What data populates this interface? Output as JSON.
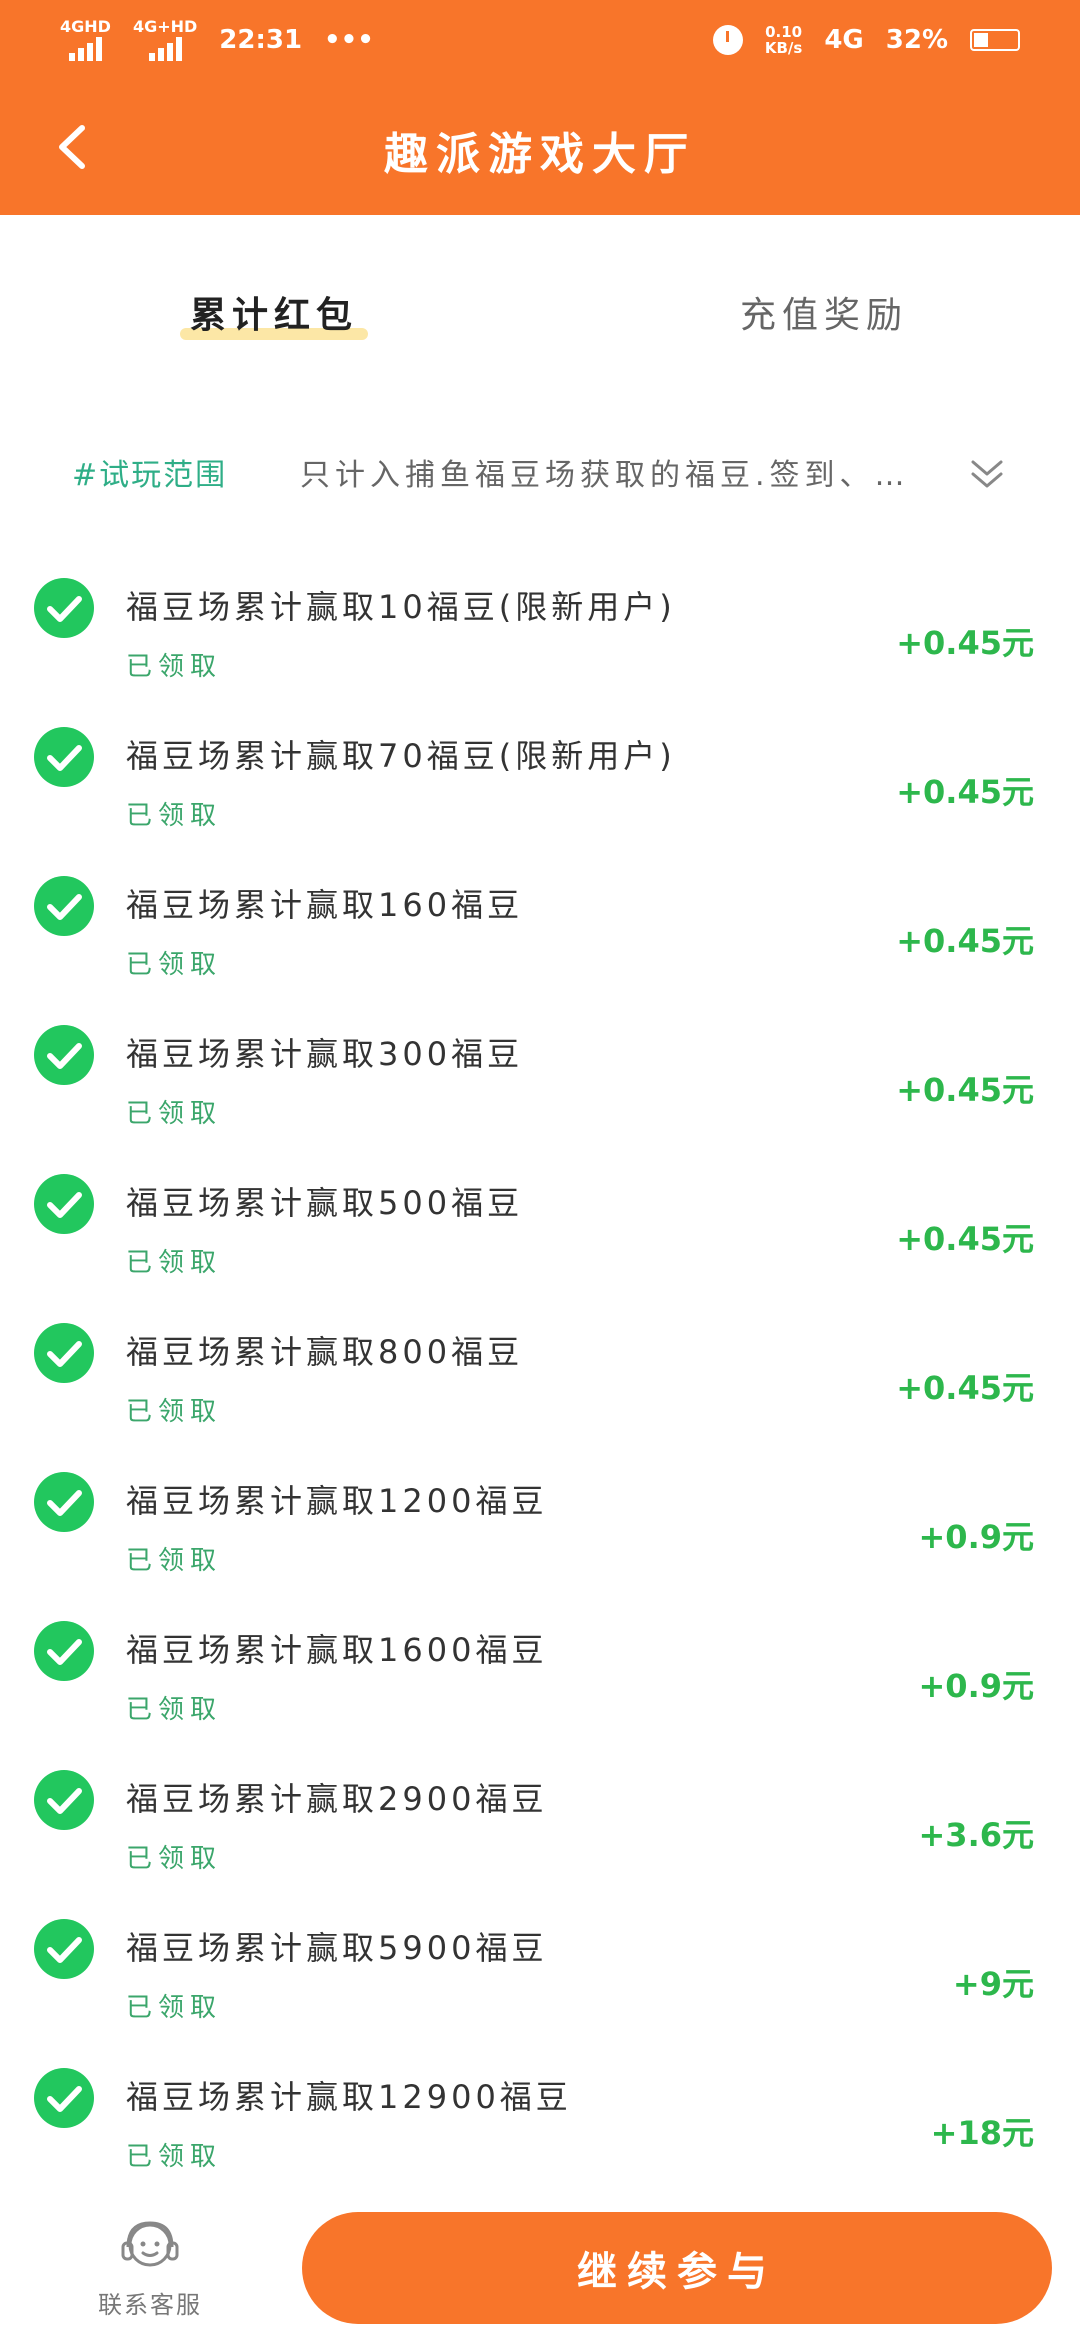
{
  "status_bar": {
    "signal1": "4GHD",
    "signal2": "4G+HD",
    "time": "22:31",
    "dots": "•••",
    "speed_value": "0.10",
    "speed_unit": "KB/s",
    "network": "4G",
    "battery": "32%"
  },
  "header": {
    "title": "趣派游戏大厅"
  },
  "tabs": [
    {
      "label": "累计红包",
      "active": true
    },
    {
      "label": "充值奖励",
      "active": false
    }
  ],
  "scope": {
    "tag": "#试玩范围",
    "text": "只计入捕鱼福豆场获取的福豆.签到、…"
  },
  "items": [
    {
      "title": "福豆场累计赢取10福豆(限新用户)",
      "status": "已领取",
      "amount": "+0.45元"
    },
    {
      "title": "福豆场累计赢取70福豆(限新用户)",
      "status": "已领取",
      "amount": "+0.45元"
    },
    {
      "title": "福豆场累计赢取160福豆",
      "status": "已领取",
      "amount": "+0.45元"
    },
    {
      "title": "福豆场累计赢取300福豆",
      "status": "已领取",
      "amount": "+0.45元"
    },
    {
      "title": "福豆场累计赢取500福豆",
      "status": "已领取",
      "amount": "+0.45元"
    },
    {
      "title": "福豆场累计赢取800福豆",
      "status": "已领取",
      "amount": "+0.45元"
    },
    {
      "title": "福豆场累计赢取1200福豆",
      "status": "已领取",
      "amount": "+0.9元"
    },
    {
      "title": "福豆场累计赢取1600福豆",
      "status": "已领取",
      "amount": "+0.9元"
    },
    {
      "title": "福豆场累计赢取2900福豆",
      "status": "已领取",
      "amount": "+3.6元"
    },
    {
      "title": "福豆场累计赢取5900福豆",
      "status": "已领取",
      "amount": "+9元"
    },
    {
      "title": "福豆场累计赢取12900福豆",
      "status": "已领取",
      "amount": "+18元"
    }
  ],
  "bottom": {
    "service_label": "联系客服",
    "continue_label": "继续参与"
  },
  "colors": {
    "brand": "#F8752A",
    "success": "#22C75E",
    "amount": "#2DB74C",
    "scope_tag": "#2FAE87"
  }
}
